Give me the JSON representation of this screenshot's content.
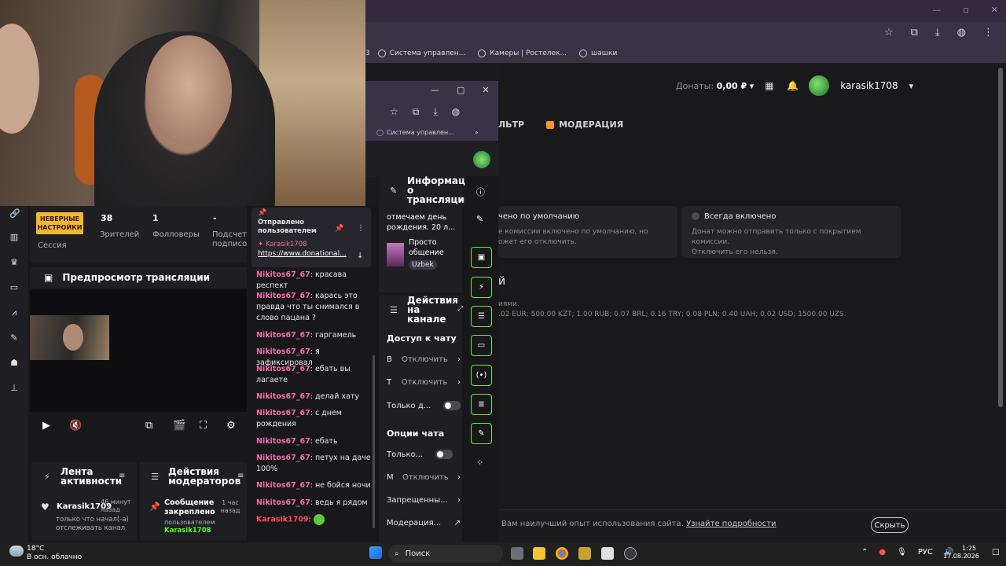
{
  "bg_browser": {
    "bookmarks": [
      "Система управлен...",
      "Камеры | Ростелек...",
      "шашки"
    ],
    "bookmark_cut": "3",
    "donations_label": "Донаты:",
    "donations_value": "0,00 ₽",
    "username": "karasik1708",
    "tab_partial": "ЛЬТР",
    "tab_moderation": "МОДЕРАЦИЯ",
    "card1_title": "чено по умолчанию",
    "card1_desc": "е комиссии включено по умолчанию, но\nожет его отключить.",
    "card2_title": "Всегда включено",
    "card2_desc": "Донат можно отправить только с покрытием комиссии.\nОтключить его нельзя.",
    "section_heading": "й",
    "section_line1": "иями.",
    "section_line2": ".02 EUR; 500.00 KZT; 1.00 RUB; 0.07 BRL; 0.16 TRY; 0.08 PLN; 0.40 UAH; 0.02 USD; 1500.00 UZS.",
    "cookie_text": "Вам наилучший опыт использования сайта.",
    "cookie_link": "Узнайте подробности",
    "cookie_button": "Скрыть"
  },
  "win2": {
    "bookmark": "Система управлен..."
  },
  "stats": {
    "badge": "НЕВЕРНЫЕ НАСТРОЙКИ",
    "session_label": "Сессия",
    "viewers_value": "38",
    "viewers_label": "Зрителей",
    "followers_value": "1",
    "followers_label": "Фолловеры",
    "subs_value": "-",
    "subs_label": "Подсчет подписок"
  },
  "preview": {
    "title": "Предпросмотр трансляции"
  },
  "activity": {
    "title": "Лента активности",
    "user": "Karasik1709",
    "time": "46 минут назад",
    "text": "только что начал(-а) отслеживать канал"
  },
  "mod_actions": {
    "title": "Действия модераторов",
    "event": "Сообщение закреплено",
    "time": "1 час назад",
    "by": "пользователем",
    "user": "Karasik1708"
  },
  "chat": {
    "pinned_label": "Отправлено пользователем",
    "pinned_user": "Karasik1708",
    "pinned_link": "https://www.donational...",
    "messages": [
      {
        "nick": "Nikitos67_67",
        "text": "красава респект"
      },
      {
        "nick": "Nikitos67_67",
        "text": "карась это правда что ты снимался в слово пацана ?"
      },
      {
        "nick": "Nikitos67_67",
        "text": "гаргамель"
      },
      {
        "nick": "Nikitos67_67",
        "text": "я зафиксировал"
      },
      {
        "nick": "Nikitos67_67",
        "text": "ебать вы лагаете"
      },
      {
        "nick": "Nikitos67_67",
        "text": "делай хату"
      },
      {
        "nick": "Nikitos67_67",
        "text": "с днем рождения"
      },
      {
        "nick": "Nikitos67_67",
        "text": "ебать"
      },
      {
        "nick": "Nikitos67_67",
        "text": "петух на даче 100%"
      },
      {
        "nick": "Nikitos67_67",
        "text": "не бойся ночи"
      },
      {
        "nick": "Nikitos67_67",
        "text": "ведь я рядом"
      },
      {
        "nick": "Karasik1709",
        "text": ""
      }
    ]
  },
  "info": {
    "title": "Информация о трансляции",
    "stream_title": "отмечаем день рождения. 20 л...",
    "category": "Просто общение",
    "tag": "Uzbek"
  },
  "actions": {
    "title": "Действия на канале",
    "chat_access": "Доступ к чату",
    "row1_prefix": "В",
    "row1_action": "Отключить",
    "row2_prefix": "Т",
    "row2_action": "Отключить",
    "only_label": "Только д...",
    "chat_options": "Опции чата",
    "only2_label": "Только...",
    "row3_prefix": "М",
    "row3_action": "Отключить",
    "banned": "Запрещенны...",
    "moderation": "Модерация..."
  },
  "taskbar": {
    "temp": "18°C",
    "weather": "В осн. облачно",
    "search": "Поиск",
    "lang": "РУС",
    "time": "1:25",
    "date": "17.08.2026"
  }
}
